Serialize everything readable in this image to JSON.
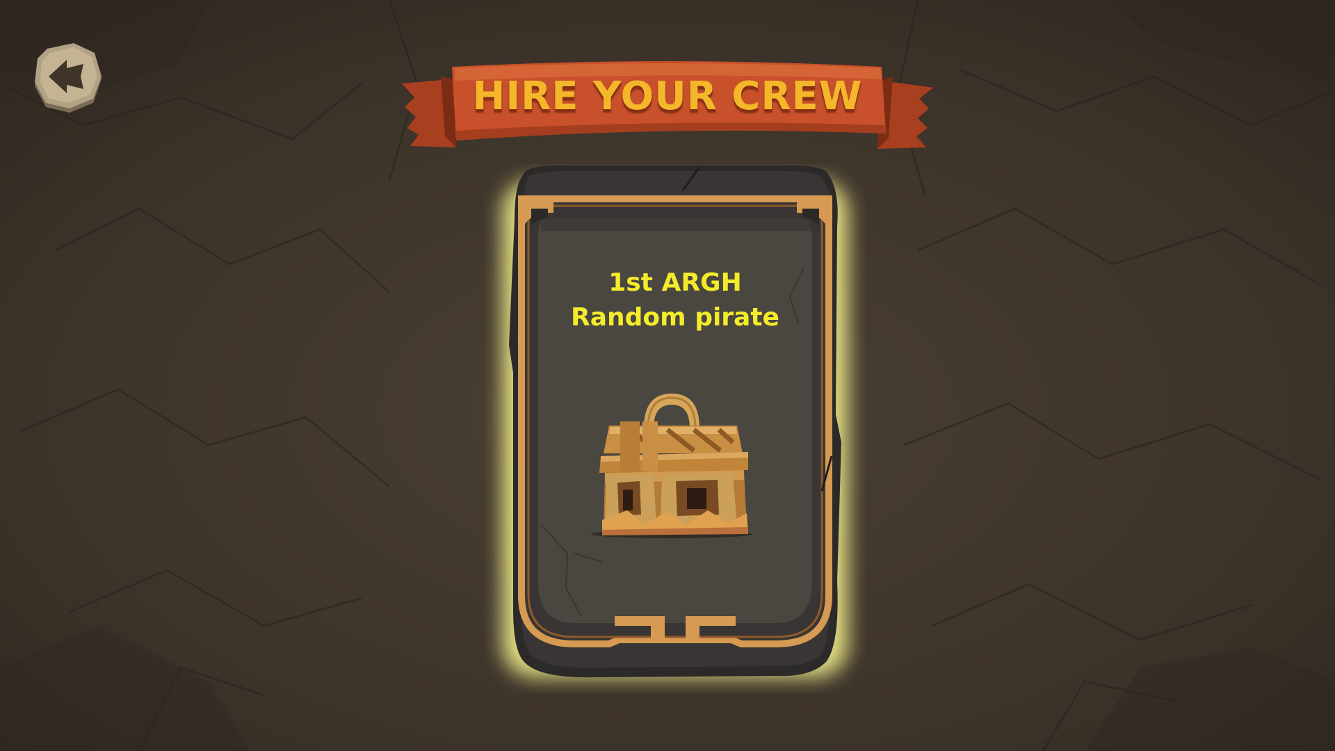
{
  "screen": {
    "title": "HIRE YOUR CREW"
  },
  "back_button": {
    "icon": "back-arrow-icon"
  },
  "card": {
    "title": "1st ARGH",
    "subtitle": "Random pirate",
    "icon": "treasure-chest-icon",
    "glow_color": "#f3ee8a",
    "text_color": "#f4ec2a"
  },
  "colors": {
    "background": "#3a3128",
    "banner": "#c8502a",
    "banner_text": "#f5b72a",
    "card_frame": "#d69a52",
    "card_stone": "#343130"
  }
}
